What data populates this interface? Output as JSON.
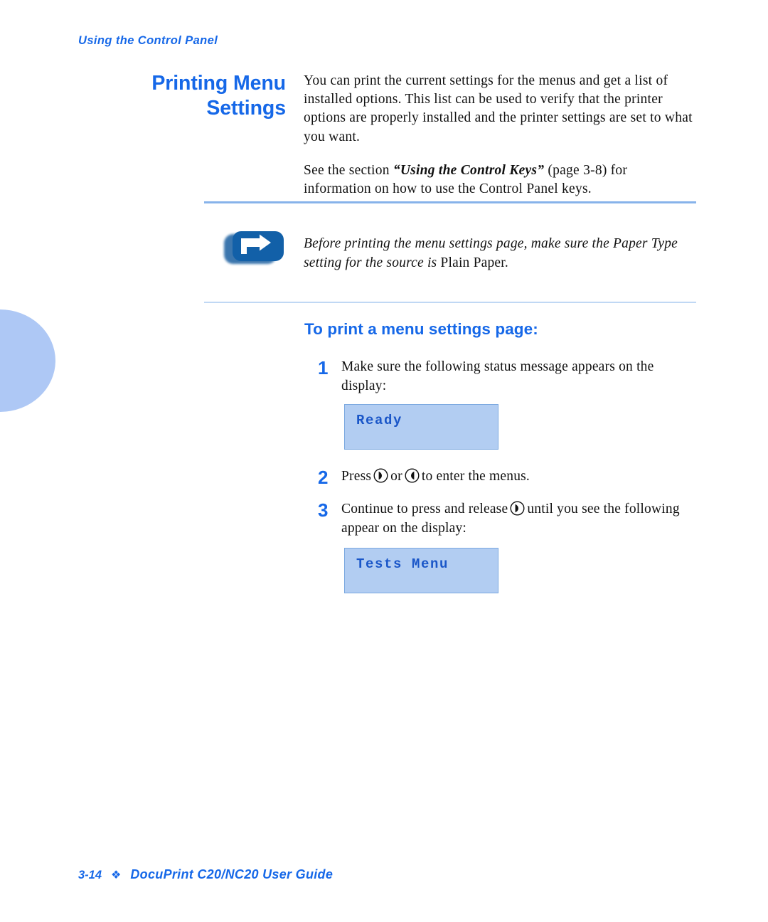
{
  "document": {
    "running_header": "Using the Control Panel",
    "section_title_line1": "Printing Menu",
    "section_title_line2": "Settings"
  },
  "intro": {
    "paragraph1": "You can print the current settings for the menus and get a list of installed options. This list can be used to verify that the printer options are properly installed and the printer settings are set to what you want.",
    "paragraph2_before": "See the section ",
    "paragraph2_reference": "“Using the Control Keys”",
    "paragraph2_after": " (page 3-8) for information on how to use the Control Panel keys."
  },
  "note": {
    "icon": "note-arrow-icon",
    "text_italic": "Before printing the menu settings page, make sure the Paper Type setting for the source is ",
    "text_roman": "Plain Paper."
  },
  "procedure": {
    "heading": "To print a menu settings page:",
    "steps": [
      {
        "number": "1",
        "text": "Make sure the following status message appears on the display:"
      },
      {
        "number": "2",
        "text_part1": "Press",
        "text_part2": "or",
        "text_part3": "to enter the menus."
      },
      {
        "number": "3",
        "text_part1": "Continue to press and release",
        "text_part2": "until you see the following appear on the display:"
      }
    ],
    "keys": {
      "right": "right-arrow-key-icon",
      "left": "left-arrow-key-icon"
    }
  },
  "displays": [
    {
      "name": "status-display-ready",
      "text": "Ready"
    },
    {
      "name": "status-display-tests-menu",
      "text": "Tests Menu"
    }
  ],
  "footer": {
    "page_number": "3-14",
    "separator": "❖",
    "title": "DocuPrint C20/NC20 User Guide"
  },
  "colors": {
    "accent_blue": "#1668e8",
    "lcd_fill": "#b2cdf2",
    "lcd_border": "#7aa8e0",
    "rule": "#87b3ea",
    "tab": "#aec8f5",
    "note_icon": "#1260a8"
  }
}
